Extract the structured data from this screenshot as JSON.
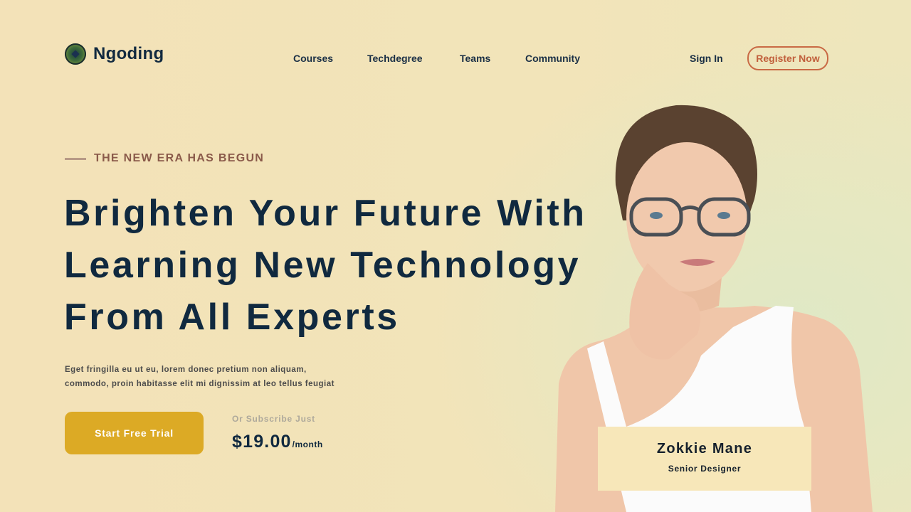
{
  "brand": {
    "name": "Ngoding",
    "icon": "logo-icon"
  },
  "nav": {
    "items": [
      {
        "label": "Courses"
      },
      {
        "label": "Techdegree"
      },
      {
        "label": "Teams"
      },
      {
        "label": "Community"
      }
    ],
    "sign_in": "Sign In",
    "register": "Register Now"
  },
  "hero": {
    "eyebrow": "THE NEW ERA HAS BEGUN",
    "headline": [
      "Brighten Your Future With",
      "Learning New Technology",
      "From All Experts"
    ],
    "description": [
      "Eget fringilla eu ut eu, lorem donec pretium non aliquam,",
      "commodo, proin habitasse elit mi dignissim at leo tellus feugiat"
    ],
    "cta": "Start Free Trial",
    "subscribe_label": "Or Subscribe Just",
    "price": "$19.00",
    "price_period": "/month"
  },
  "profile": {
    "name": "Zokkie Mane",
    "role": "Senior Designer",
    "image": "woman-with-glasses-portrait"
  },
  "colors": {
    "background": "#f3e2b8",
    "navy": "#10293f",
    "accent_orange": "#c96a45",
    "cta_yellow": "#dcaa25",
    "card": "#f7e7b9"
  }
}
